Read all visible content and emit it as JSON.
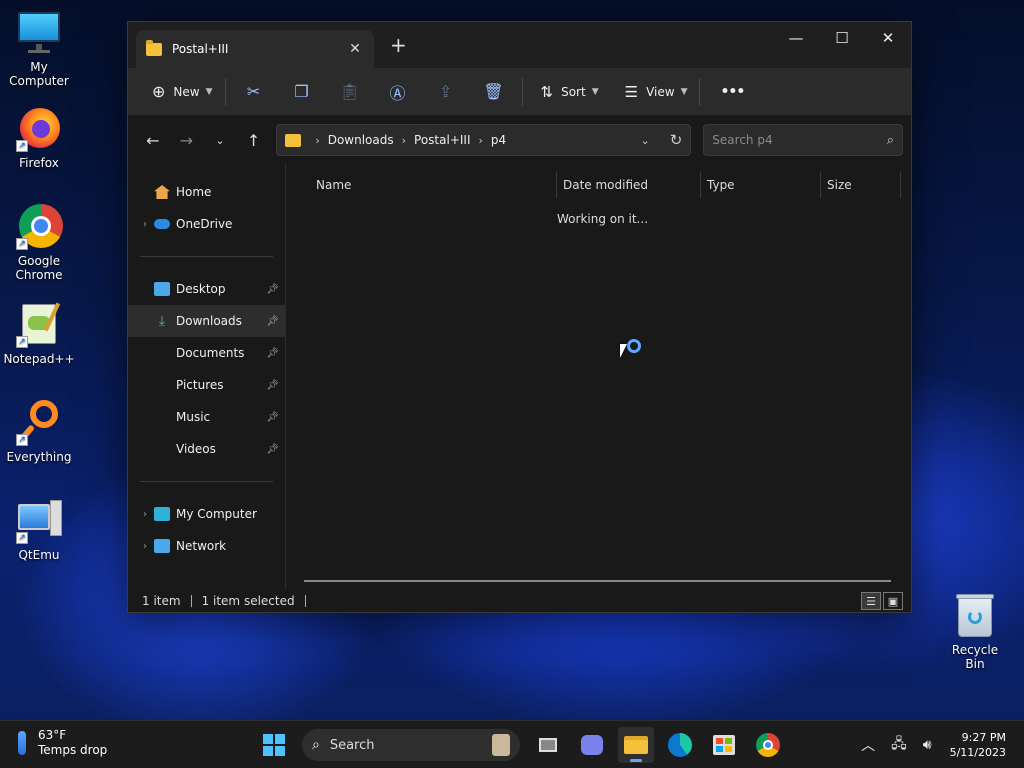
{
  "desktop": {
    "icons": [
      {
        "label": "My Computer"
      },
      {
        "label": "Firefox"
      },
      {
        "label": "Google Chrome"
      },
      {
        "label": "Notepad++"
      },
      {
        "label": "Everything"
      },
      {
        "label": "QtEmu"
      }
    ],
    "recycle_bin": "Recycle Bin"
  },
  "window": {
    "tab_title": "Postal+III",
    "toolbar": {
      "new_label": "New",
      "sort_label": "Sort",
      "view_label": "View",
      "more_label": "•••"
    },
    "address": {
      "crumbs": [
        "Downloads",
        "Postal+III",
        "p4"
      ]
    },
    "search_placeholder": "Search p4",
    "nav_pane": {
      "home": "Home",
      "onedrive": "OneDrive",
      "quick": [
        "Desktop",
        "Downloads",
        "Documents",
        "Pictures",
        "Music",
        "Videos"
      ],
      "my_computer": "My Computer",
      "network": "Network"
    },
    "columns": [
      "Name",
      "Date modified",
      "Type",
      "Size"
    ],
    "working_text": "Working on it...",
    "status": {
      "items": "1 item",
      "selected": "1 item selected"
    }
  },
  "taskbar": {
    "weather_temp": "63°F",
    "weather_desc": "Temps drop",
    "search_label": "Search",
    "time": "9:27 PM",
    "date": "5/11/2023"
  },
  "colors": {
    "accent": "#5aa9ff",
    "folder": "#f3c13a"
  }
}
